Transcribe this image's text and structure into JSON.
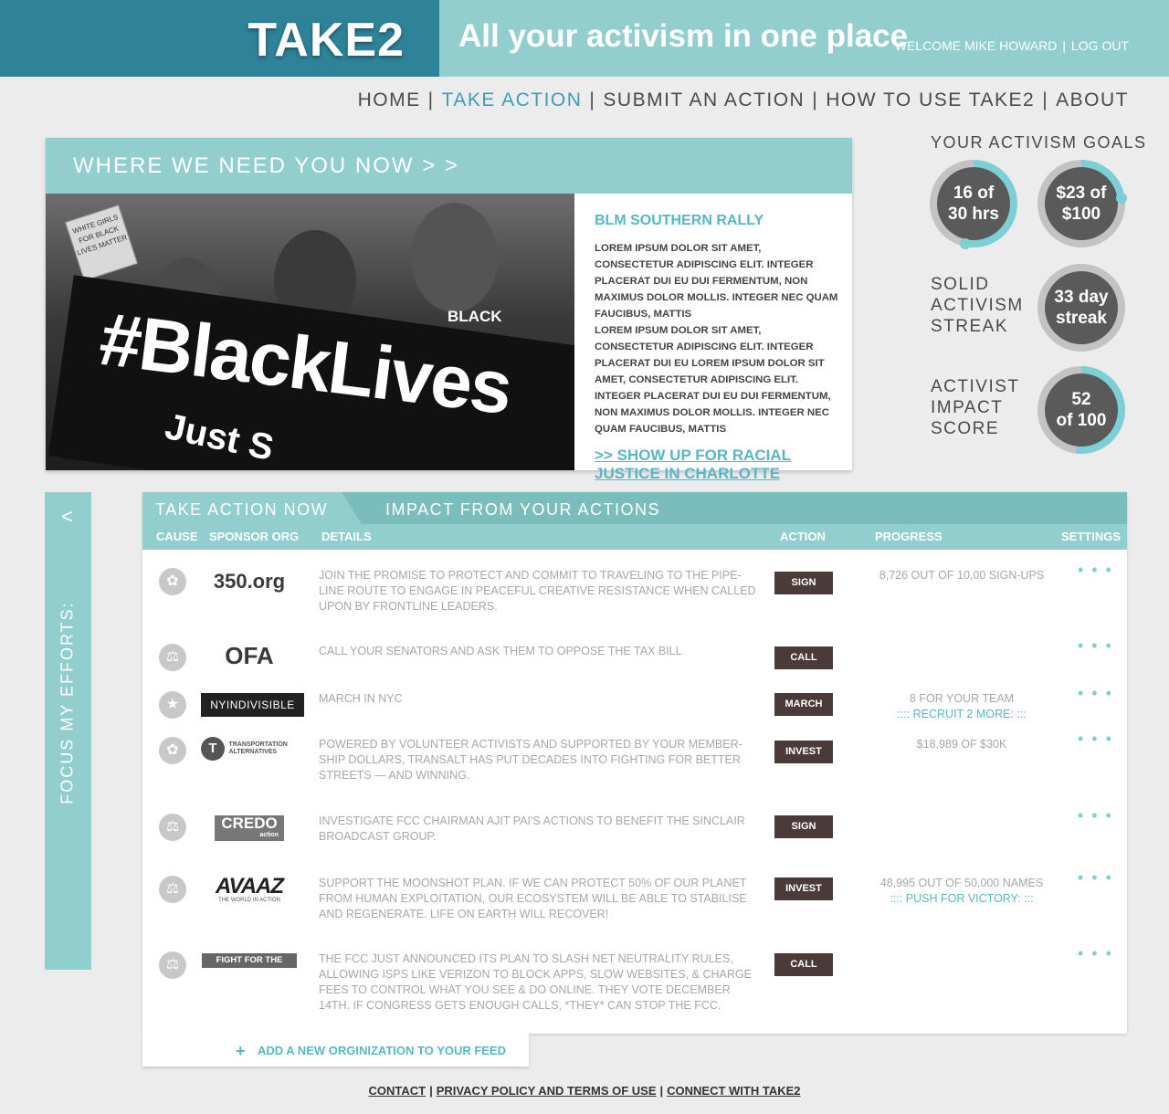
{
  "header": {
    "logo": "TAKE2",
    "tagline": "All your activism in one place",
    "welcome": "WELCOME MIKE HOWARD",
    "separator": "|",
    "logout": "LOG OUT"
  },
  "nav": {
    "items": [
      "HOME",
      "TAKE ACTION",
      "SUBMIT AN ACTION",
      "HOW TO USE TAKE2",
      "ABOUT"
    ],
    "active": "TAKE ACTION",
    "separator": "|"
  },
  "feature": {
    "heading": "WHERE WE NEED YOU NOW > >",
    "title": "BLM SOUTHERN RALLY",
    "text1": "LOREM IPSUM DOLOR SIT AMET, CONSECTETUR ADIPISCING ELIT. INTEGER PLACERAT DUI EU DUI FERMENTUM, NON MAXIMUS DOLOR MOLLIS. INTEGER NEC QUAM FAUCIBUS, MATTIS",
    "text2": "LOREM IPSUM DOLOR SIT AMET, CONSECTETUR ADIPISCING ELIT. INTEGER PLACERAT DUI EU LOREM IPSUM DOLOR SIT AMET, CONSECTETUR ADIPISCING ELIT. INTEGER PLACERAT DUI EU DUI FERMENTUM, NON MAXIMUS DOLOR MOLLIS. INTEGER NEC QUAM FAUCIBUS, MATTIS",
    "link": ">> SHOW UP FOR RACIAL JUSTICE IN CHARLOTTE",
    "photo_banner": "#BlackLives",
    "photo_banner_sub": "Just S",
    "photo_sign": "BLACK IS",
    "photo_placard": "WHITE GIRLS FOR BLACK LIVES MATTER"
  },
  "goals": {
    "title": "YOUR ACTIVISM GOALS",
    "hours": {
      "line1": "16 of",
      "line2": "30 hrs",
      "fraction": 0.53
    },
    "money": {
      "line1": "$23 of",
      "line2": "$100",
      "fraction": 0.23
    },
    "streak": {
      "label": [
        "SOLID",
        "ACTIVISM",
        "STREAK"
      ],
      "line1": "33 day",
      "line2": "streak"
    },
    "impact": {
      "label": [
        "ACTIVIST",
        "IMPACT",
        "SCORE"
      ],
      "line1": "52",
      "line2": "of 100",
      "fraction": 0.52
    }
  },
  "side_tab": {
    "label": "FOCUS MY EFFORTS:",
    "arrow": "<"
  },
  "actions": {
    "tabs": [
      "TAKE ACTION NOW",
      "IMPACT FROM YOUR ACTIONS"
    ],
    "columns": [
      "CAUSE",
      "SPONSOR ORG",
      "DETAILS",
      "ACTION",
      "PROGRESS",
      "SETTINGS"
    ],
    "settings_icon": "• • •",
    "rows": [
      {
        "cause": "leaf",
        "org": "350.org",
        "details": "JOIN THE PROMISE TO PROTECT AND COMMIT TO TRAVELING TO THE PIPE-LINE ROUTE TO ENGAGE IN PEACEFUL CREATIVE RESISTANCE WHEN CALLED UPON BY FRONTLINE LEADERS.",
        "action": "SIGN",
        "progress": "8,726 OUT OF 10,00 SIGN-UPS",
        "progress_link": ""
      },
      {
        "cause": "scales",
        "org": "OFA",
        "details": "CALL YOUR SENATORS AND ASK THEM TO OPPOSE THE TAX BILL",
        "action": "CALL",
        "progress": "",
        "progress_link": ""
      },
      {
        "cause": "star",
        "org": "NYINDIVISIBLE",
        "details": "MARCH IN NYC",
        "action": "MARCH",
        "progress": "8  FOR YOUR TEAM",
        "progress_link": ":::: RECRUIT 2 MORE: :::"
      },
      {
        "cause": "leaf",
        "org": "TRANSPORTATION ALTERNATIVES",
        "details": "POWERED BY VOLUNTEER ACTIVISTS AND SUPPORTED BY YOUR MEMBER-SHIP DOLLARS, TRANSALT HAS PUT DECADES INTO FIGHTING FOR BETTER STREETS — AND WINNING.",
        "action": "INVEST",
        "progress": "$18,989 OF $30K",
        "progress_link": ""
      },
      {
        "cause": "scales",
        "org": "CREDO",
        "org_sub": "action",
        "details": "INVESTIGATE FCC CHAIRMAN AJIT PAI'S ACTIONS TO BENEFIT THE SINCLAIR BROADCAST GROUP.",
        "action": "SIGN",
        "progress": "",
        "progress_link": ""
      },
      {
        "cause": "scales",
        "org": "AVAAZ",
        "org_sub": "THE WORLD IN ACTION",
        "details": "SUPPORT THE MOONSHOT PLAN. IF WE CAN PROTECT 50% OF OUR PLANET FROM HUMAN EXPLOITATION, OUR ECOSYSTEM WILL BE ABLE TO STABILISE AND REGENERATE. LIFE ON EARTH WILL RECOVER!",
        "action": "INVEST",
        "progress": "48,995 OUT OF 50,000 NAMES",
        "progress_link": ":::: PUSH FOR VICTORY: :::"
      },
      {
        "cause": "scales",
        "org": "FIGHT FOR THE FUTURE",
        "details": "THE FCC JUST ANNOUNCED ITS PLAN TO SLASH NET NEUTRALITY RULES, ALLOWING ISPS LIKE VERIZON TO BLOCK APPS, SLOW WEBSITES, & CHARGE FEES TO CONTROL WHAT YOU SEE & DO ONLINE. THEY VOTE DECEMBER 14TH. IF CONGRESS GETS ENOUGH CALLS, *THEY* CAN STOP THE FCC.",
        "action": "CALL",
        "progress": "",
        "progress_link": ""
      }
    ]
  },
  "add_org": {
    "icon": "+",
    "label": "ADD A NEW ORGINIZATION TO YOUR FEED"
  },
  "footer": {
    "links": [
      "CONTACT",
      "PRIVACY POLICY AND TERMS OF USE",
      "CONNECT WITH TAKE2"
    ],
    "separator": "|"
  },
  "colors": {
    "teal_dark": "#2e8399",
    "teal_light": "#91cecd",
    "accent": "#56b8c3",
    "button": "#4a3a3a"
  }
}
